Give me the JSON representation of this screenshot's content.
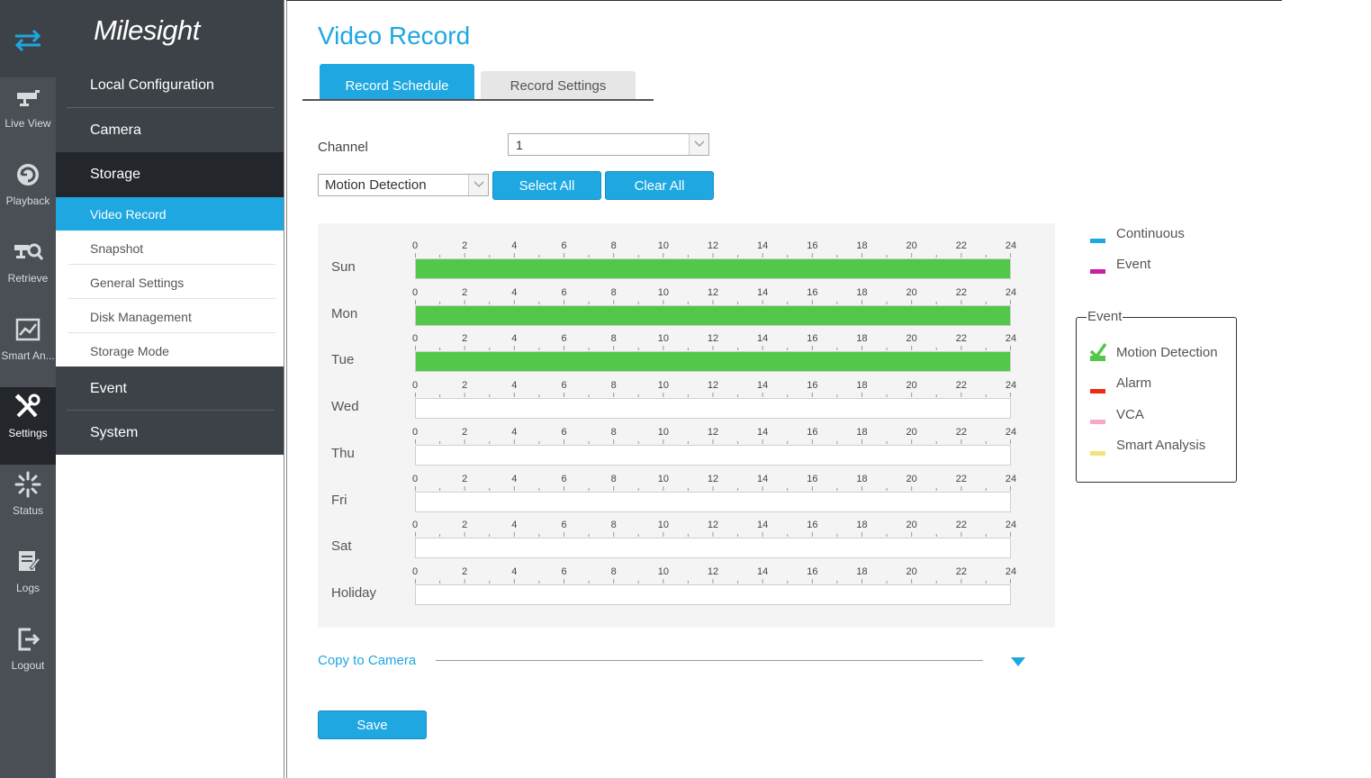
{
  "app": {
    "logo": "Milesight"
  },
  "rail": {
    "items": [
      {
        "label": "",
        "icon": "swap-arrows-icon"
      },
      {
        "label": "Live View",
        "icon": "live-view-icon"
      },
      {
        "label": "Playback",
        "icon": "playback-icon"
      },
      {
        "label": "Retrieve",
        "icon": "retrieve-icon"
      },
      {
        "label": "Smart An...",
        "icon": "smart-analysis-icon"
      },
      {
        "label": "Settings",
        "icon": "settings-icon",
        "active": true
      },
      {
        "label": "Status",
        "icon": "status-icon"
      },
      {
        "label": "Logs",
        "icon": "logs-icon"
      },
      {
        "label": "Logout",
        "icon": "logout-icon"
      }
    ]
  },
  "menu": {
    "local_configuration": "Local Configuration",
    "camera": "Camera",
    "storage": "Storage",
    "storage_sub": [
      "Video Record",
      "Snapshot",
      "General Settings",
      "Disk Management",
      "Storage Mode"
    ],
    "event": "Event",
    "system": "System"
  },
  "page": {
    "title": "Video Record",
    "tabs": [
      "Record Schedule",
      "Record Settings"
    ],
    "channel_label": "Channel",
    "channel_value": "1",
    "mode_value": "Motion Detection",
    "select_all": "Select All",
    "clear_all": "Clear All",
    "copy_to_camera": "Copy to Camera",
    "save": "Save"
  },
  "schedule": {
    "hour_ticks": [
      "0",
      "2",
      "4",
      "6",
      "8",
      "10",
      "12",
      "14",
      "16",
      "18",
      "20",
      "22",
      "24"
    ],
    "days": [
      {
        "label": "Sun",
        "fill": 1.0
      },
      {
        "label": "Mon",
        "fill": 1.0
      },
      {
        "label": "Tue",
        "fill": 1.0
      },
      {
        "label": "Wed",
        "fill": 0
      },
      {
        "label": "Thu",
        "fill": 0
      },
      {
        "label": "Fri",
        "fill": 0
      },
      {
        "label": "Sat",
        "fill": 0
      },
      {
        "label": "Holiday",
        "fill": 0
      }
    ],
    "fill_color": "#52c74a"
  },
  "legend": {
    "types": [
      {
        "label": "Continuous",
        "color": "#1ea7e1"
      },
      {
        "label": "Event",
        "color": "#c71fa8"
      }
    ],
    "event_title": "Event",
    "events": [
      {
        "label": "Motion Detection",
        "color": "#52c74a",
        "selected": true
      },
      {
        "label": "Alarm",
        "color": "#ee2a12"
      },
      {
        "label": "VCA",
        "color": "#f7a8c9"
      },
      {
        "label": "Smart Analysis",
        "color": "#f7e07a"
      }
    ]
  }
}
